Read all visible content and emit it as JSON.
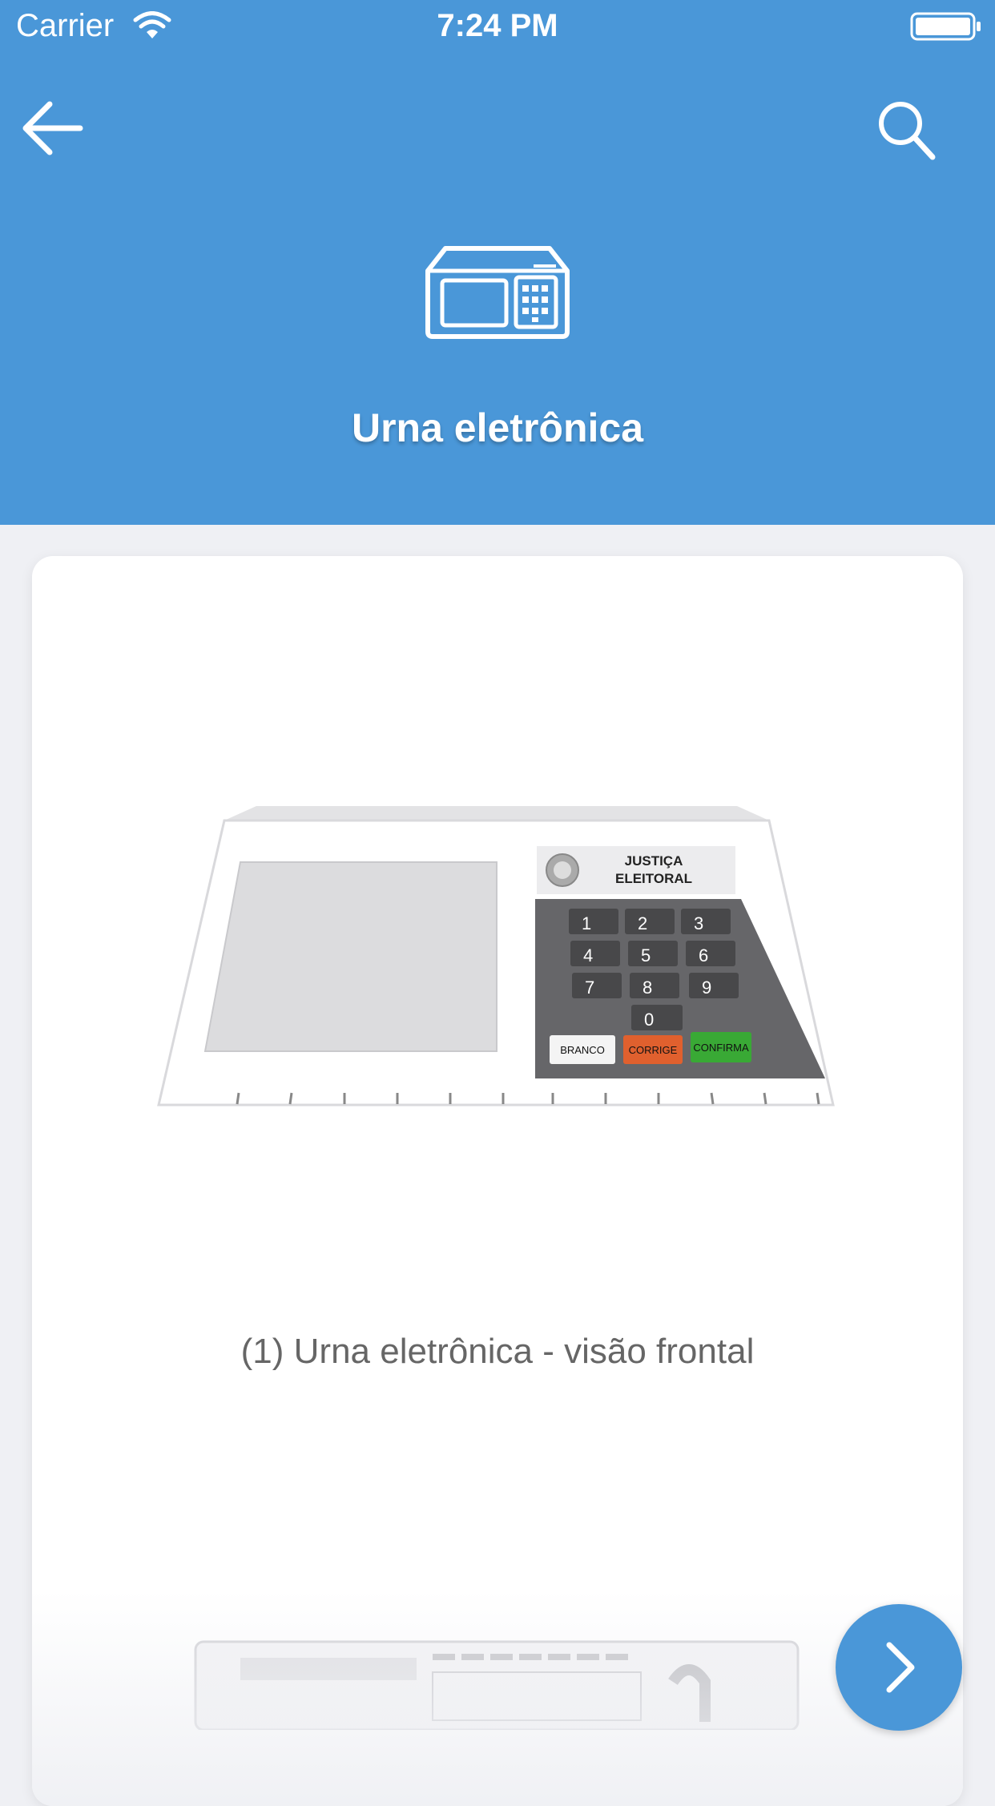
{
  "status_bar": {
    "carrier": "Carrier",
    "time": "7:24 PM"
  },
  "header": {
    "title": "Urna eletrônica",
    "back_icon": "arrow-left-icon",
    "search_icon": "search-icon",
    "category_icon": "voting-machine-icon",
    "background_color": "#4a97d8"
  },
  "card": {
    "image_label": {
      "line1": "JUSTIÇA",
      "line2": "ELEITORAL"
    },
    "keypad": {
      "keys": [
        "1",
        "2",
        "3",
        "4",
        "5",
        "6",
        "7",
        "8",
        "9",
        "0"
      ],
      "branco": "BRANCO",
      "corrige": "CORRIGE",
      "confirma": "CONFIRMA"
    },
    "caption": "(1) Urna eletrônica - visão frontal"
  },
  "next_button": {
    "icon": "chevron-right-icon"
  }
}
